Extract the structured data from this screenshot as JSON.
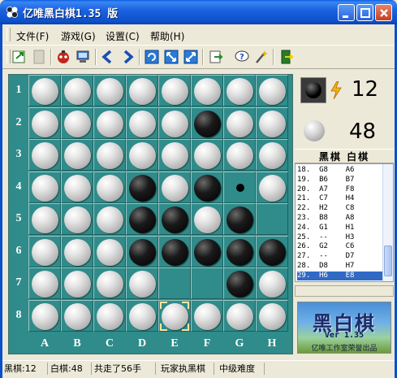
{
  "window": {
    "title": "亿唯黑白棋1.35 版"
  },
  "menu": [
    {
      "label": "文件(F)"
    },
    {
      "label": "游戏(G)"
    },
    {
      "label": "设置(C)"
    },
    {
      "label": "帮助(H)"
    }
  ],
  "toolbar": {
    "icons": [
      "new-game-icon",
      "disabled-icon",
      "robot-icon",
      "computer-icon",
      "undo-icon",
      "redo-icon",
      "refresh-icon",
      "zoom-in-icon",
      "zoom-out-icon",
      "export-icon",
      "help-icon",
      "wand-icon",
      "exit-icon"
    ]
  },
  "board": {
    "columns": [
      "A",
      "B",
      "C",
      "D",
      "E",
      "F",
      "G",
      "H"
    ],
    "rows": [
      "1",
      "2",
      "3",
      "4",
      "5",
      "6",
      "7",
      "8"
    ],
    "cells": [
      [
        "W",
        "W",
        "W",
        "W",
        "W",
        "W",
        "W",
        "W"
      ],
      [
        "W",
        "W",
        "W",
        "W",
        "W",
        "B",
        "W",
        "W"
      ],
      [
        "W",
        "W",
        "W",
        "W",
        "W",
        "W",
        "W",
        "W"
      ],
      [
        "W",
        "W",
        "W",
        "B",
        "W",
        "B",
        "hint",
        "W"
      ],
      [
        "W",
        "W",
        "W",
        "B",
        "B",
        "W",
        "B",
        ""
      ],
      [
        "W",
        "W",
        "W",
        "B",
        "B",
        "B",
        "B",
        "B"
      ],
      [
        "W",
        "W",
        "W",
        "W",
        "",
        "",
        "B",
        "W"
      ],
      [
        "W",
        "W",
        "W",
        "W",
        "W",
        "W",
        "W",
        "W"
      ]
    ],
    "last_move": "E8"
  },
  "score": {
    "black": "12",
    "white": "48"
  },
  "moves": {
    "header": "黑棋 白棋",
    "items": [
      "18.  G8    A6",
      "19.  B6    B7",
      "20.  A7    F8",
      "21.  C7    H4",
      "22.  H2    C8",
      "23.  B8    A8",
      "24.  G1    H1",
      "25.  --    H3",
      "26.  G2    C6",
      "27.  --    D7",
      "28.  D8    H7",
      "29.  H6    E8"
    ],
    "selected_index": 11
  },
  "logo": {
    "title": "黑白棋",
    "version": "Ver 1.35",
    "credit": "亿唯工作室荣誉出品"
  },
  "status": {
    "black": "黑棋:12",
    "white": "白棋:48",
    "moves": "共走了56手",
    "player": "玩家执黑棋",
    "level": "中级难度"
  },
  "colors": {
    "board": "#2f8c8a",
    "titlebar": "#0b4fc9",
    "selection": "#316ac5"
  }
}
